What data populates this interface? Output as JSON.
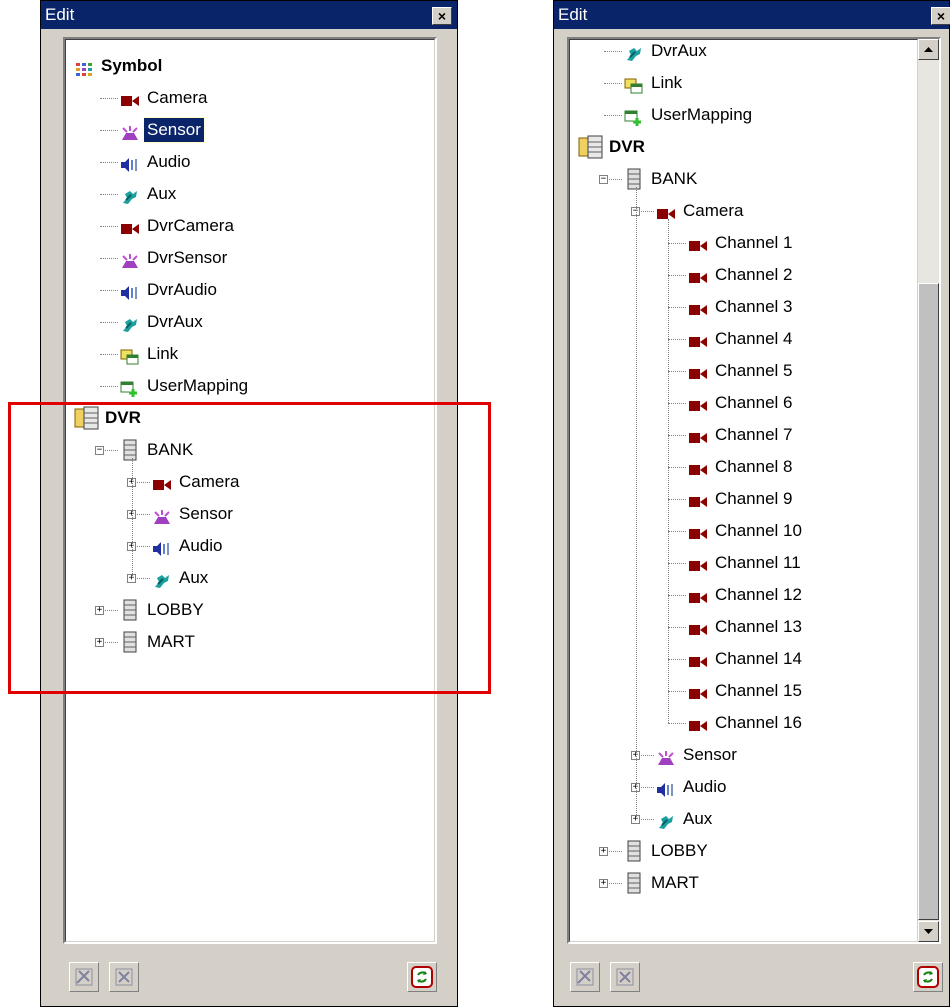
{
  "left_panel": {
    "title": "Edit",
    "close_glyph": "×",
    "tree": [
      {
        "label": "Symbol",
        "icon": "symbol-grid-icon",
        "bold": true,
        "level": 0
      },
      {
        "label": "Camera",
        "icon": "camera-icon",
        "level": 1
      },
      {
        "label": "Sensor",
        "icon": "sensor-icon",
        "level": 1,
        "selected": true
      },
      {
        "label": "Audio",
        "icon": "audio-icon",
        "level": 1
      },
      {
        "label": "Aux",
        "icon": "aux-icon",
        "level": 1
      },
      {
        "label": "DvrCamera",
        "icon": "camera-icon",
        "level": 1
      },
      {
        "label": "DvrSensor",
        "icon": "sensor-icon",
        "level": 1
      },
      {
        "label": "DvrAudio",
        "icon": "audio-icon",
        "level": 1
      },
      {
        "label": "DvrAux",
        "icon": "aux-icon",
        "level": 1
      },
      {
        "label": "Link",
        "icon": "link-icon",
        "level": 1
      },
      {
        "label": "UserMapping",
        "icon": "user-mapping-icon",
        "level": 1
      },
      {
        "label": "DVR",
        "icon": "dvr-root-icon",
        "bold": true,
        "level": 0
      },
      {
        "label": "BANK",
        "icon": "server-icon",
        "level": 1,
        "expander": "−"
      },
      {
        "label": "Camera",
        "icon": "camera-icon",
        "level": 2,
        "expander": "+"
      },
      {
        "label": "Sensor",
        "icon": "sensor-icon",
        "level": 2,
        "expander": "+"
      },
      {
        "label": "Audio",
        "icon": "audio-icon",
        "level": 2,
        "expander": "+"
      },
      {
        "label": "Aux",
        "icon": "aux-icon",
        "level": 2,
        "expander": "+"
      },
      {
        "label": "LOBBY",
        "icon": "server-icon",
        "level": 1,
        "expander": "+"
      },
      {
        "label": "MART",
        "icon": "server-icon",
        "level": 1,
        "expander": "+"
      }
    ]
  },
  "right_panel": {
    "title": "Edit",
    "close_glyph": "×",
    "tree": [
      {
        "label": "DvrAux",
        "icon": "aux-icon",
        "level": 1
      },
      {
        "label": "Link",
        "icon": "link-icon",
        "level": 1
      },
      {
        "label": "UserMapping",
        "icon": "user-mapping-icon",
        "level": 1
      },
      {
        "label": "DVR",
        "icon": "dvr-root-icon",
        "bold": true,
        "level": 0
      },
      {
        "label": "BANK",
        "icon": "server-icon",
        "level": 1,
        "expander": "−"
      },
      {
        "label": "Camera",
        "icon": "camera-icon",
        "level": 2,
        "expander": "−"
      },
      {
        "label": "Channel 1",
        "icon": "camera-icon",
        "level": 3
      },
      {
        "label": "Channel 2",
        "icon": "camera-icon",
        "level": 3
      },
      {
        "label": "Channel 3",
        "icon": "camera-icon",
        "level": 3
      },
      {
        "label": "Channel 4",
        "icon": "camera-icon",
        "level": 3
      },
      {
        "label": "Channel 5",
        "icon": "camera-icon",
        "level": 3
      },
      {
        "label": "Channel 6",
        "icon": "camera-icon",
        "level": 3
      },
      {
        "label": "Channel 7",
        "icon": "camera-icon",
        "level": 3
      },
      {
        "label": "Channel 8",
        "icon": "camera-icon",
        "level": 3
      },
      {
        "label": "Channel 9",
        "icon": "camera-icon",
        "level": 3
      },
      {
        "label": "Channel 10",
        "icon": "camera-icon",
        "level": 3
      },
      {
        "label": "Channel 11",
        "icon": "camera-icon",
        "level": 3
      },
      {
        "label": "Channel 12",
        "icon": "camera-icon",
        "level": 3
      },
      {
        "label": "Channel 13",
        "icon": "camera-icon",
        "level": 3
      },
      {
        "label": "Channel 14",
        "icon": "camera-icon",
        "level": 3
      },
      {
        "label": "Channel 15",
        "icon": "camera-icon",
        "level": 3
      },
      {
        "label": "Channel 16",
        "icon": "camera-icon",
        "level": 3
      },
      {
        "label": "Sensor",
        "icon": "sensor-icon",
        "level": 2,
        "expander": "+"
      },
      {
        "label": "Audio",
        "icon": "audio-icon",
        "level": 2,
        "expander": "+"
      },
      {
        "label": "Aux",
        "icon": "aux-icon",
        "level": 2,
        "expander": "+"
      },
      {
        "label": "LOBBY",
        "icon": "server-icon",
        "level": 1,
        "expander": "+"
      },
      {
        "label": "MART",
        "icon": "server-icon",
        "level": 1,
        "expander": "+"
      }
    ]
  },
  "footer_buttons": [
    "edit-icon",
    "delete-icon",
    "refresh-icon"
  ],
  "colors": {
    "titlebar": "#0a246a",
    "selection": "#0a246a",
    "highlight_box": "#e00000",
    "camera": "#8b0000"
  }
}
